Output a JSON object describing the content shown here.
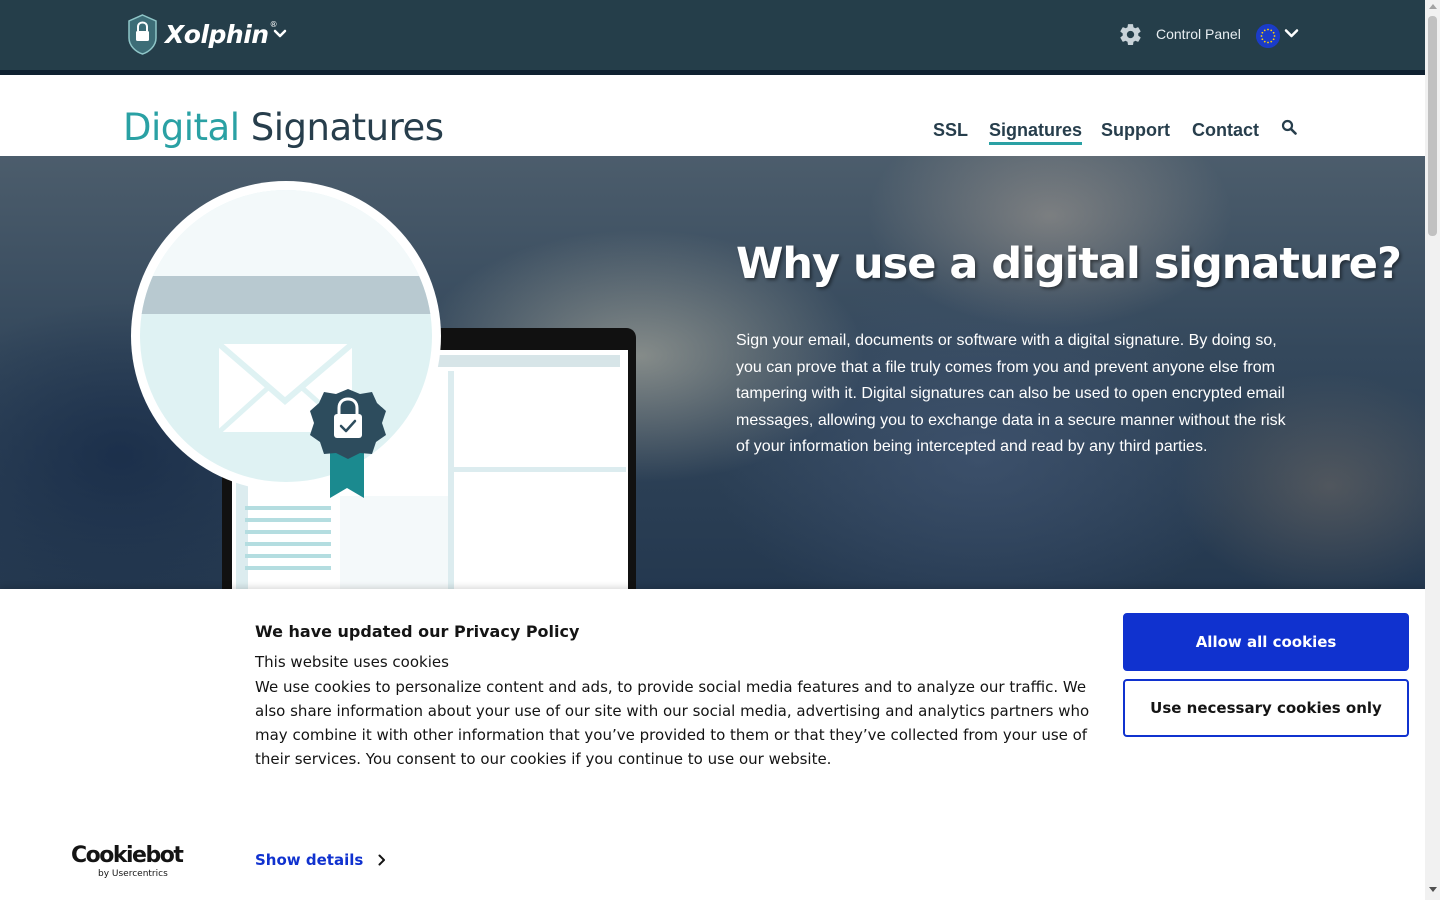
{
  "topbar": {
    "brand": "Xolphin",
    "brand_mark": "®",
    "control_panel_label": "Control Panel",
    "icons": {
      "shield": "shield-lock-icon",
      "gear": "gear-icon",
      "flag": "eu-flag-icon"
    }
  },
  "header": {
    "title_part1": "Digital",
    "title_part2": "Signatures",
    "nav": [
      {
        "label": "SSL"
      },
      {
        "label": "Signatures",
        "active": true
      },
      {
        "label": "Support"
      },
      {
        "label": "Contact"
      }
    ]
  },
  "hero": {
    "title": "Why use a digital signature?",
    "body": "Sign your email, documents or software with a digital signature. By doing so, you can prove that a file truly comes from you and prevent anyone else from tampering with it. Digital signatures can also be used to open encrypted email messages, allowing you to exchange data in a secure manner without the risk of your information being intercepted and read by any third parties."
  },
  "cookie": {
    "title": "We have updated our Privacy Policy",
    "subtitle": "This website uses cookies",
    "body": "We use cookies to personalize content and ads, to provide social media features and to analyze our traffic. We also share information about your use of our site with our social media, advertising and analytics partners who may combine it with other information that you’ve provided to them or that they’ve collected from your use of their services. You consent to our cookies if you continue to use our website.",
    "allow_label": "Allow all cookies",
    "necessary_label": "Use necessary cookies only",
    "details_label": "Show details",
    "logo_main": "Cookiebot",
    "logo_sub": "by Usercentrics"
  },
  "colors": {
    "topbar": "#253e4a",
    "teal": "#2aa1a4",
    "navy": "#273e4c",
    "cookie_blue": "#1032cf"
  }
}
